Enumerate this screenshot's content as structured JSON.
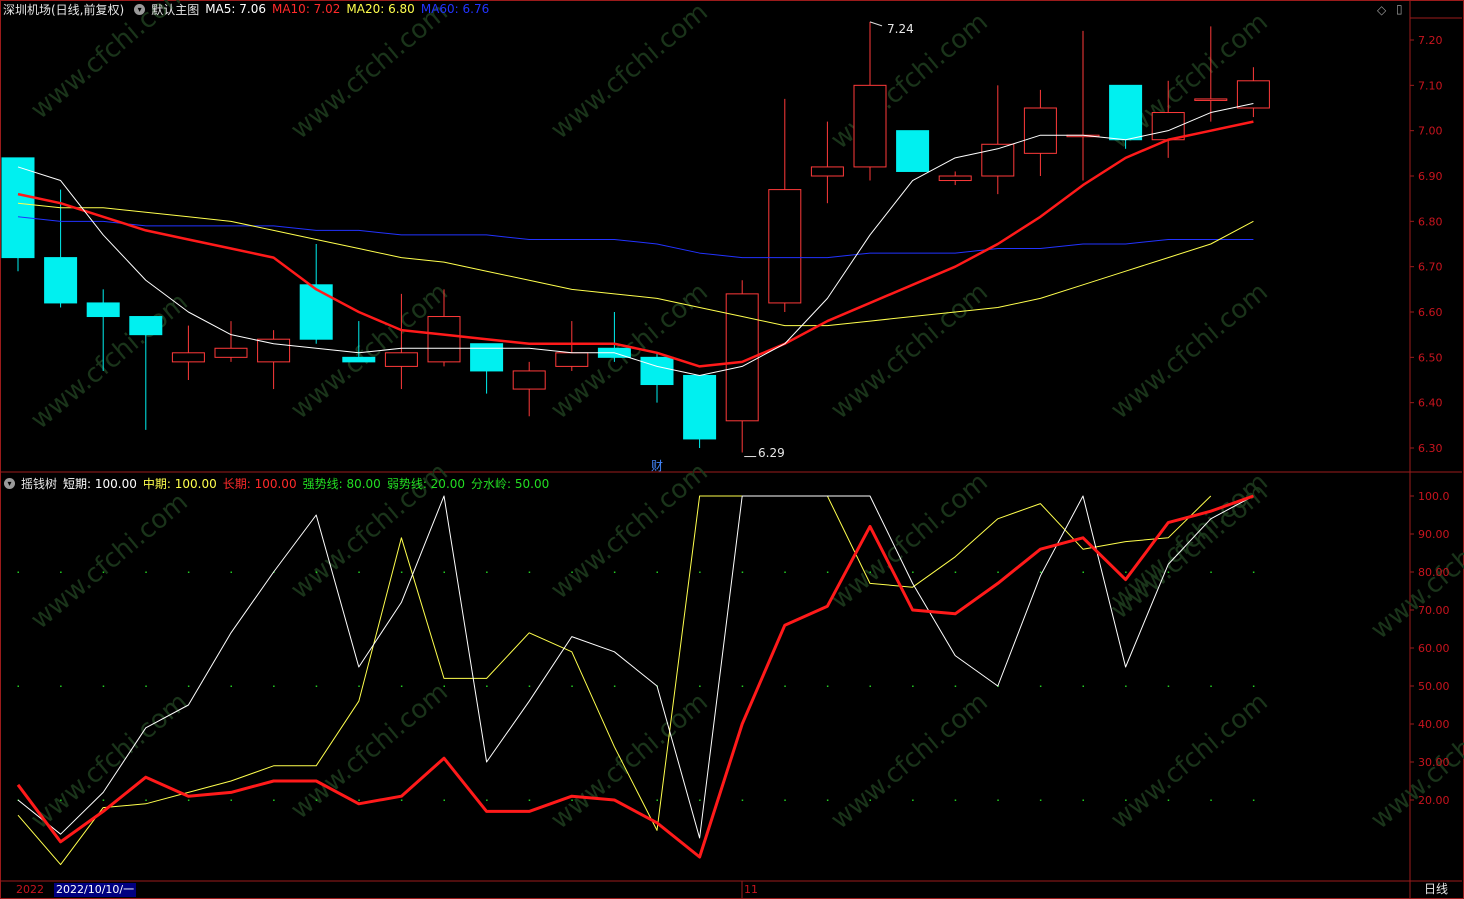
{
  "colors": {
    "background": "#000000",
    "frame": "#9b1b1b",
    "candle_up": "#ff3a3a",
    "candle_down": "#00f0f0",
    "ma5": "#ffffff",
    "ma10": "#ff1a1a",
    "ma20": "#ffff4d",
    "ma60": "#2233ff",
    "axis_text": "#c8141e",
    "watermark": "#1a3a1a"
  },
  "price_header": {
    "title": "深圳机场(日线,前复权)",
    "main_label": "默认主图",
    "ma5": "MA5: 7.06",
    "ma10": "MA10: 7.02",
    "ma20": "MA20: 6.80",
    "ma60": "MA60: 6.76"
  },
  "indicator_header": {
    "title": "摇钱树",
    "short": "短期: 100.00",
    "mid": "中期: 100.00",
    "long": "长期: 100.00",
    "strong": "强势线: 80.00",
    "weak": "弱势线: 20.00",
    "water": "分水岭: 50.00"
  },
  "annotations": {
    "high": "7.24",
    "low": "6.29",
    "fin_marker": "财",
    "month_marker": "11"
  },
  "bottom_bar": {
    "year_label": "2022",
    "date_label": "2022/10/10/一",
    "period_label": "日线"
  },
  "chart_data": [
    {
      "type": "candlestick",
      "title": "深圳机场(日线,前复权)",
      "y_ticks": [
        "7.20",
        "7.10",
        "7.00",
        "6.90",
        "6.80",
        "6.70",
        "6.60",
        "6.50",
        "6.40",
        "6.30"
      ],
      "ylim": [
        6.275,
        7.265
      ],
      "candles": [
        {
          "o": 6.94,
          "h": 6.94,
          "l": 6.69,
          "c": 6.72
        },
        {
          "o": 6.72,
          "h": 6.87,
          "l": 6.61,
          "c": 6.62
        },
        {
          "o": 6.62,
          "h": 6.65,
          "l": 6.47,
          "c": 6.59
        },
        {
          "o": 6.59,
          "h": 6.59,
          "l": 6.34,
          "c": 6.55
        },
        {
          "o": 6.49,
          "h": 6.57,
          "l": 6.45,
          "c": 6.51
        },
        {
          "o": 6.5,
          "h": 6.58,
          "l": 6.49,
          "c": 6.52
        },
        {
          "o": 6.49,
          "h": 6.56,
          "l": 6.43,
          "c": 6.54
        },
        {
          "o": 6.66,
          "h": 6.75,
          "l": 6.53,
          "c": 6.54
        },
        {
          "o": 6.5,
          "h": 6.58,
          "l": 6.49,
          "c": 6.49
        },
        {
          "o": 6.48,
          "h": 6.64,
          "l": 6.43,
          "c": 6.51
        },
        {
          "o": 6.49,
          "h": 6.65,
          "l": 6.48,
          "c": 6.59
        },
        {
          "o": 6.53,
          "h": 6.53,
          "l": 6.42,
          "c": 6.47
        },
        {
          "o": 6.43,
          "h": 6.49,
          "l": 6.37,
          "c": 6.47
        },
        {
          "o": 6.48,
          "h": 6.58,
          "l": 6.47,
          "c": 6.51
        },
        {
          "o": 6.52,
          "h": 6.6,
          "l": 6.49,
          "c": 6.5
        },
        {
          "o": 6.5,
          "h": 6.51,
          "l": 6.4,
          "c": 6.44
        },
        {
          "o": 6.46,
          "h": 6.46,
          "l": 6.3,
          "c": 6.32
        },
        {
          "o": 6.36,
          "h": 6.67,
          "l": 6.29,
          "c": 6.64
        },
        {
          "o": 6.62,
          "h": 7.07,
          "l": 6.6,
          "c": 6.87
        },
        {
          "o": 6.9,
          "h": 7.02,
          "l": 6.84,
          "c": 6.92
        },
        {
          "o": 6.92,
          "h": 7.24,
          "l": 6.89,
          "c": 7.1
        },
        {
          "o": 7.0,
          "h": 7.0,
          "l": 6.91,
          "c": 6.91
        },
        {
          "o": 6.89,
          "h": 6.91,
          "l": 6.88,
          "c": 6.9
        },
        {
          "o": 6.9,
          "h": 7.1,
          "l": 6.86,
          "c": 6.97
        },
        {
          "o": 6.95,
          "h": 7.09,
          "l": 6.9,
          "c": 7.05
        },
        {
          "o": 6.99,
          "h": 7.22,
          "l": 6.89,
          "c": 6.99
        },
        {
          "o": 7.1,
          "h": 7.1,
          "l": 6.96,
          "c": 6.98
        },
        {
          "o": 6.98,
          "h": 7.11,
          "l": 6.94,
          "c": 7.04
        },
        {
          "o": 7.07,
          "h": 7.23,
          "l": 7.02,
          "c": 7.07
        },
        {
          "o": 7.05,
          "h": 7.14,
          "l": 7.03,
          "c": 7.11
        }
      ],
      "ma5": [
        6.92,
        6.89,
        6.77,
        6.67,
        6.6,
        6.55,
        6.53,
        6.52,
        6.51,
        6.52,
        6.52,
        6.52,
        6.52,
        6.51,
        6.51,
        6.48,
        6.46,
        6.48,
        6.53,
        6.63,
        6.77,
        6.89,
        6.94,
        6.96,
        6.99,
        6.99,
        6.98,
        7.0,
        7.04,
        7.06
      ],
      "ma10": [
        6.86,
        6.84,
        6.81,
        6.78,
        6.76,
        6.74,
        6.72,
        6.65,
        6.6,
        6.56,
        6.55,
        6.54,
        6.53,
        6.53,
        6.53,
        6.51,
        6.48,
        6.49,
        6.53,
        6.58,
        6.62,
        6.66,
        6.7,
        6.75,
        6.81,
        6.88,
        6.94,
        6.98,
        7.0,
        7.02
      ],
      "ma20": [
        6.84,
        6.83,
        6.83,
        6.82,
        6.81,
        6.8,
        6.78,
        6.76,
        6.74,
        6.72,
        6.71,
        6.69,
        6.67,
        6.65,
        6.64,
        6.63,
        6.61,
        6.59,
        6.57,
        6.57,
        6.58,
        6.59,
        6.6,
        6.61,
        6.63,
        6.66,
        6.69,
        6.72,
        6.75,
        6.8
      ],
      "ma60": [
        6.81,
        6.8,
        6.8,
        6.79,
        6.79,
        6.79,
        6.79,
        6.78,
        6.78,
        6.77,
        6.77,
        6.77,
        6.76,
        6.76,
        6.76,
        6.75,
        6.73,
        6.72,
        6.72,
        6.72,
        6.73,
        6.73,
        6.73,
        6.74,
        6.74,
        6.75,
        6.75,
        6.76,
        6.76,
        6.76
      ]
    },
    {
      "type": "line",
      "title": "摇钱树",
      "y_ticks": [
        "100.0",
        "90.00",
        "80.00",
        "70.00",
        "60.00",
        "50.00",
        "40.00",
        "30.00",
        "20.00"
      ],
      "ylim": [
        8,
        103.5
      ],
      "levels": {
        "strong": 80,
        "weak": 20,
        "water": 50
      },
      "series": [
        {
          "name": "短期",
          "values": [
            20,
            11,
            22,
            39,
            45,
            64,
            80,
            95,
            55,
            72,
            100,
            30,
            46,
            63,
            59,
            50,
            10,
            100,
            100,
            100,
            100,
            77,
            58,
            50,
            79,
            100,
            55,
            82,
            94,
            100
          ]
        },
        {
          "name": "中期",
          "values": [
            16,
            3,
            18,
            19,
            22,
            25,
            29,
            29,
            46,
            89,
            52,
            52,
            64,
            59,
            34,
            12,
            100,
            100,
            100,
            100,
            77,
            76,
            84,
            94,
            98,
            86,
            88,
            89,
            100
          ]
        },
        {
          "name": "长期",
          "values": [
            24,
            9,
            17,
            26,
            21,
            22,
            25,
            25,
            19,
            21,
            31,
            17,
            17,
            21,
            20,
            14,
            5,
            40,
            66,
            71,
            92,
            70,
            69,
            77,
            86,
            89,
            78,
            93,
            96,
            100
          ]
        }
      ]
    }
  ]
}
